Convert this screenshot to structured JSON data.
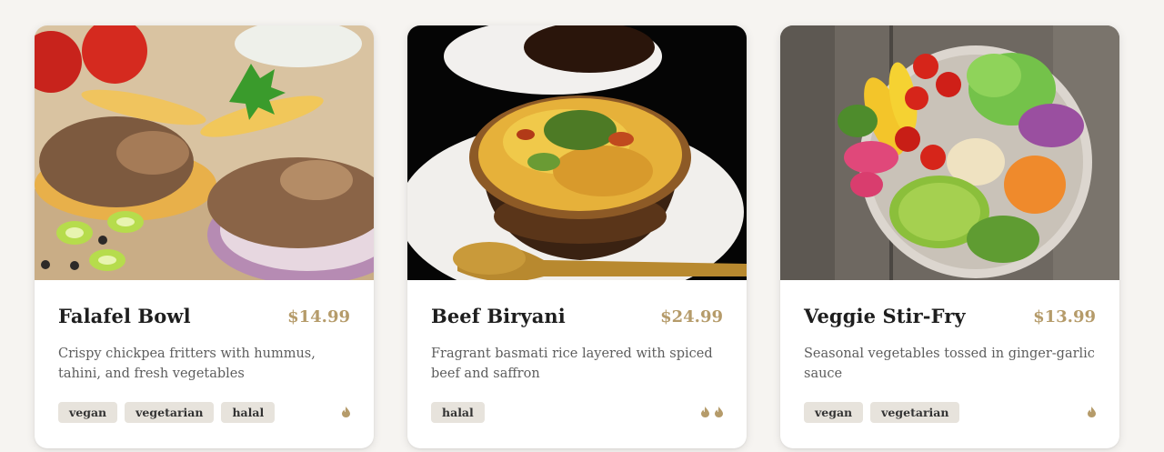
{
  "menu": {
    "items": [
      {
        "name": "Falafel Bowl",
        "price": "$14.99",
        "description": "Crispy chickpea fritters with hummus, tahini, and fresh vegetables",
        "tags": [
          "vegan",
          "vegetarian",
          "halal"
        ],
        "spice_level": 1,
        "spice_icon": "flame-icon"
      },
      {
        "name": "Beef Biryani",
        "price": "$24.99",
        "description": "Fragrant basmati rice layered with spiced beef and saffron",
        "tags": [
          "halal"
        ],
        "spice_level": 2,
        "spice_icon": "flame-icon"
      },
      {
        "name": "Veggie Stir-Fry",
        "price": "$13.99",
        "description": "Seasonal vegetables tossed in ginger-garlic sauce",
        "tags": [
          "vegan",
          "vegetarian"
        ],
        "spice_level": 1,
        "spice_icon": "flame-icon"
      }
    ]
  },
  "colors": {
    "background": "#f6f4f1",
    "price": "#b59b6a",
    "tag_background": "#e7e3dc",
    "spice": "#b59b6a"
  }
}
